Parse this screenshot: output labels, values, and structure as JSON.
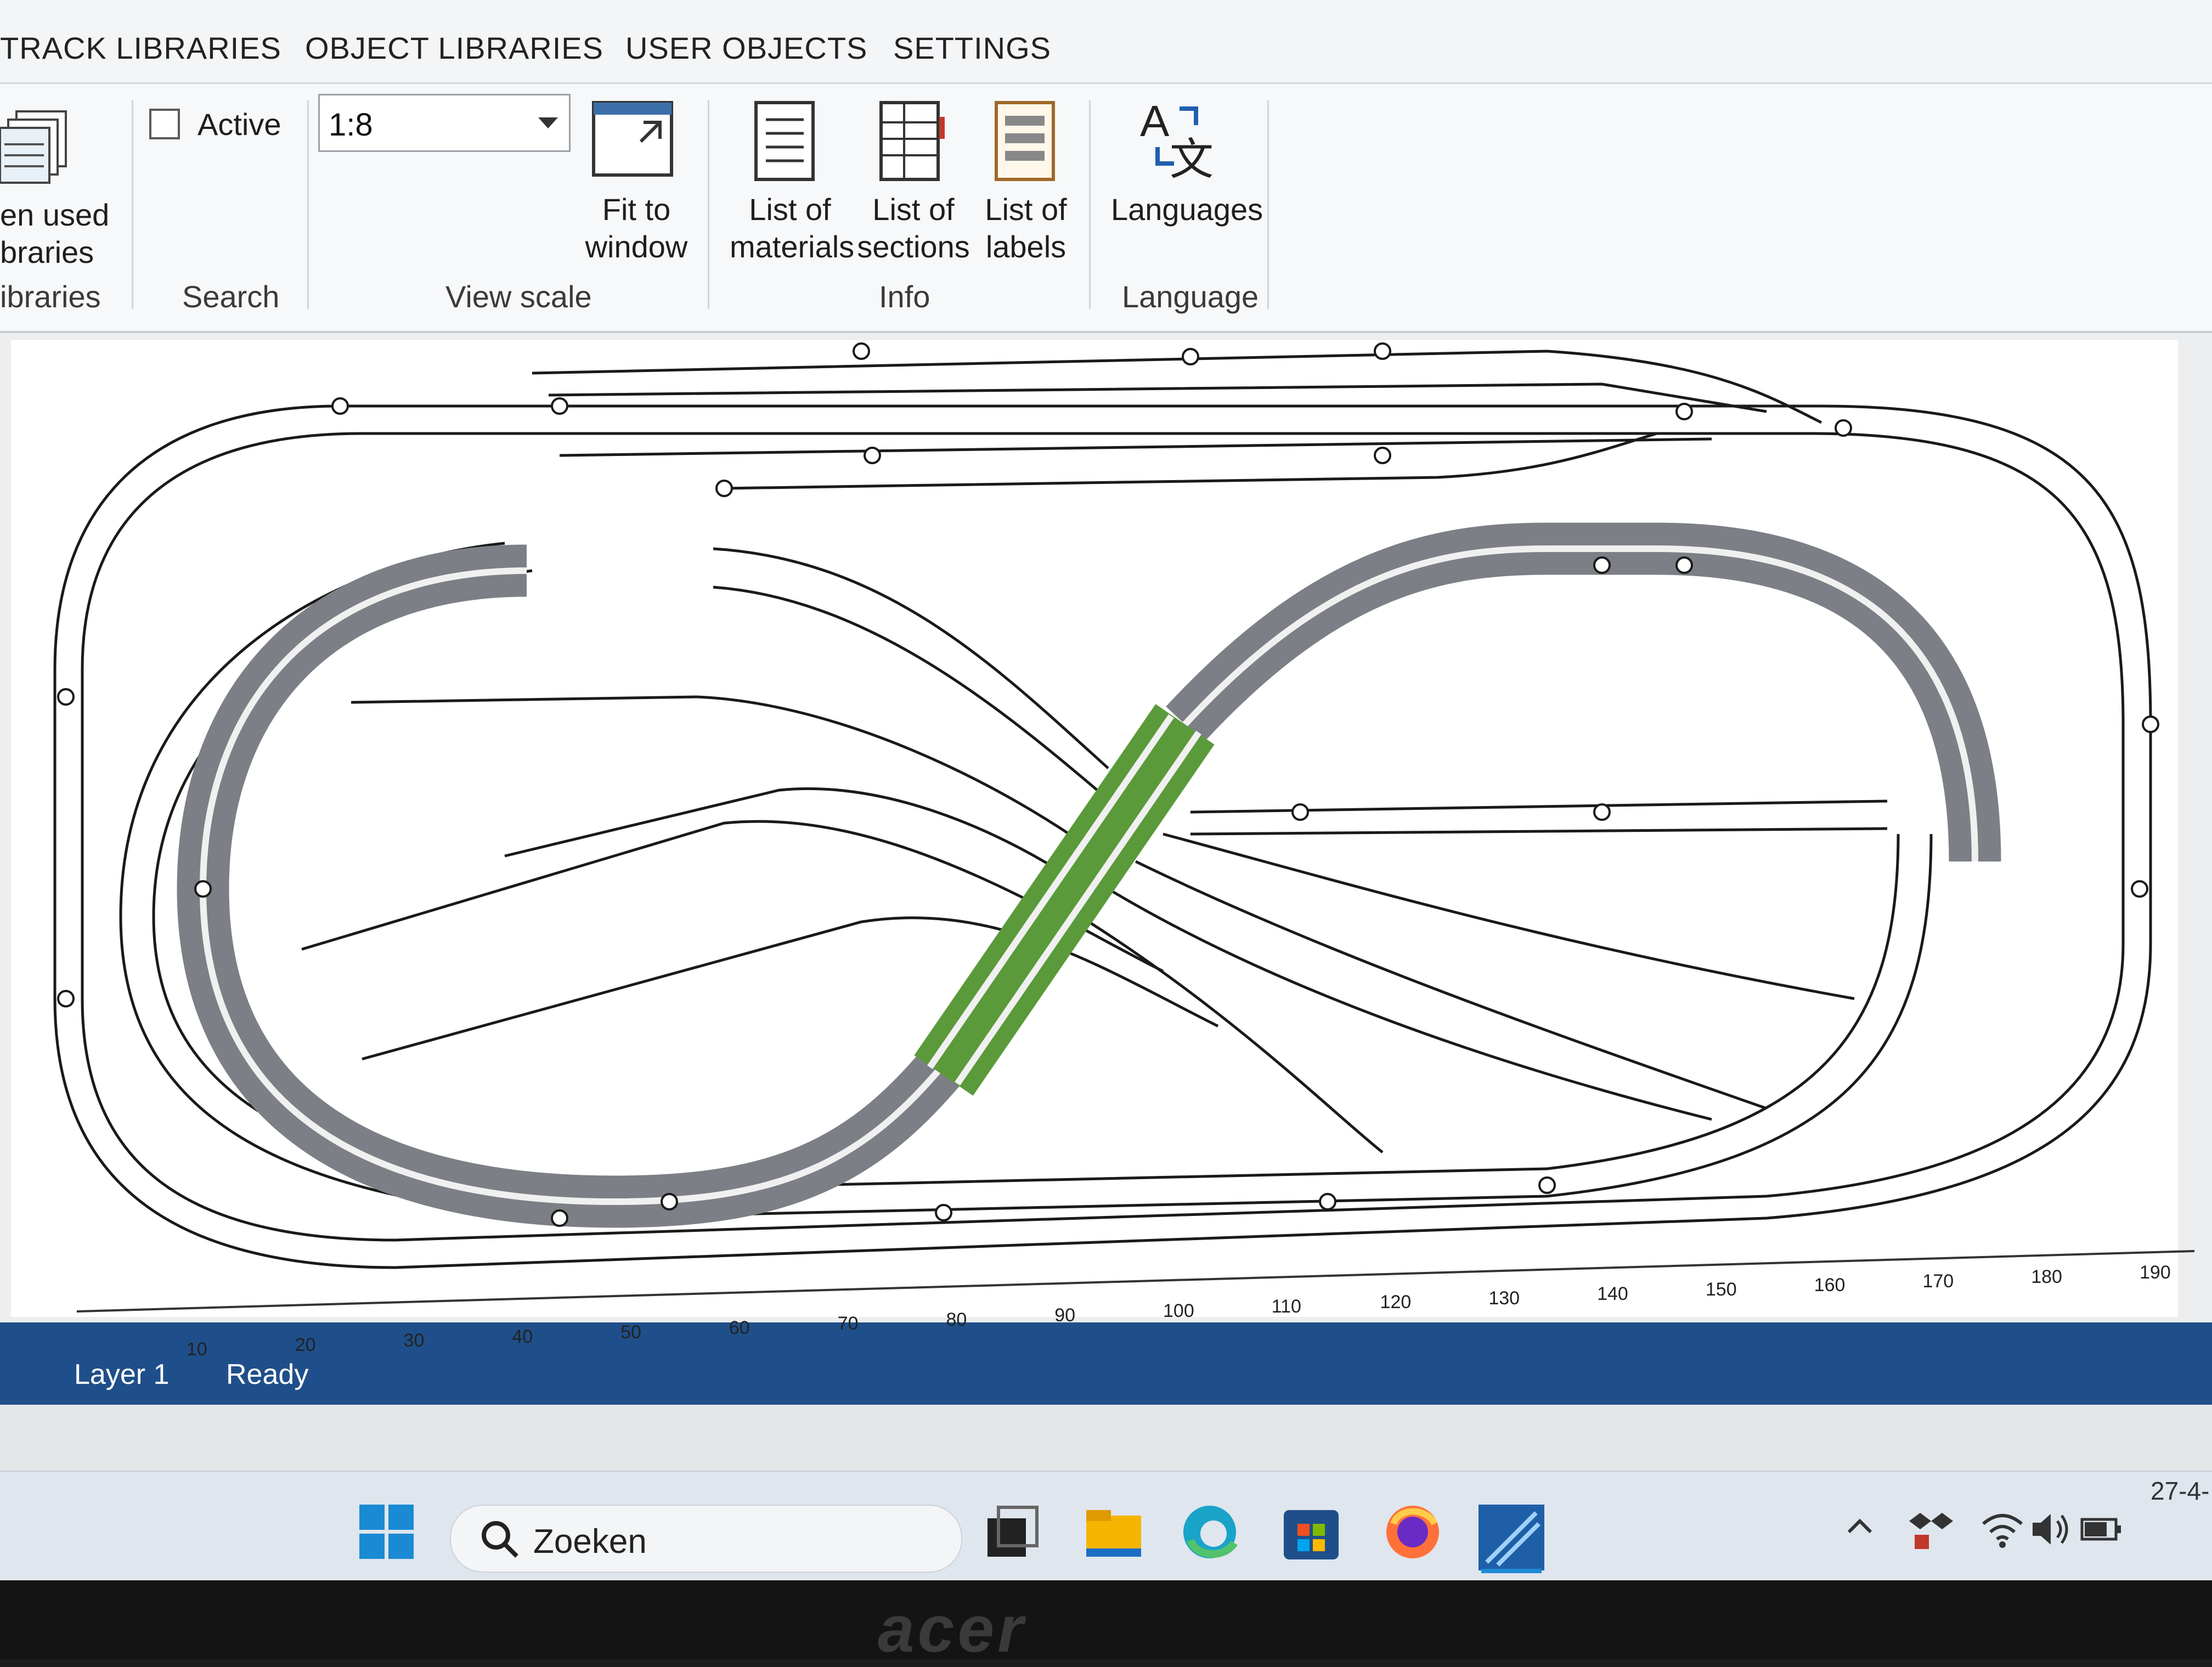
{
  "tabs": [
    "TRACK LIBRARIES",
    "OBJECT LIBRARIES",
    "USER OBJECTS",
    "SETTINGS"
  ],
  "ribbon": {
    "recent": {
      "label_line1": "en used",
      "label_line2": "braries",
      "group": "ibraries"
    },
    "search": {
      "checkbox_label": "Active",
      "group": "Search"
    },
    "view_scale": {
      "value": "1:8",
      "fit_line1": "Fit to",
      "fit_line2": "window",
      "group": "View scale"
    },
    "info": {
      "materials_line1": "List of",
      "materials_line2": "materials",
      "sections_line1": "List of",
      "sections_line2": "sections",
      "labels_line1": "List of",
      "labels_line2": "labels",
      "group": "Info"
    },
    "language": {
      "label": "Languages",
      "group": "Language"
    }
  },
  "ruler": {
    "ticks": [
      "10",
      "20",
      "30",
      "40",
      "50",
      "60",
      "70",
      "80",
      "90",
      "100",
      "110",
      "120",
      "130",
      "140",
      "150",
      "160",
      "170",
      "180",
      "190"
    ],
    "zoom": "1:8"
  },
  "statusbar": {
    "layer": "Layer 1",
    "status": "Ready"
  },
  "taskbar": {
    "search_placeholder": "Zoeken",
    "clock": "27-4-"
  },
  "bezel_brand": "acer",
  "colors": {
    "statusbar": "#1f4f8a",
    "bridge": "#5a9a3a",
    "elevated_track": "#7c7f86"
  }
}
